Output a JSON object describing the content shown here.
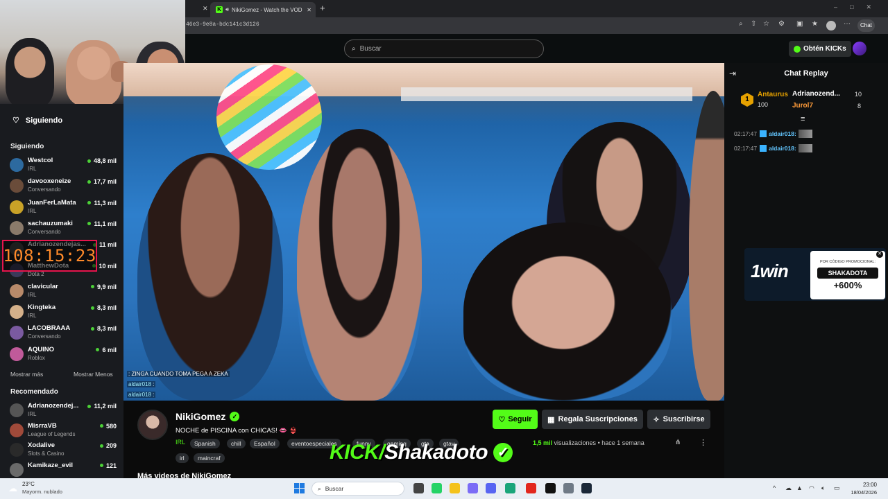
{
  "browser": {
    "tab_title": "NikiGomez - Watch the VOD",
    "tab_close": "✕",
    "new_tab": "+",
    "url": "46e3-9e8a-bdc141c3d126",
    "chat_button": "Chat"
  },
  "header": {
    "search_placeholder": "Buscar",
    "kicks_button": "Obtén KICKs"
  },
  "sidebar": {
    "following_header": "Siguiendo",
    "following_section": "Siguiendo",
    "following": [
      {
        "name": "Westcol",
        "category": "IRL",
        "viewers": "48,8 mil",
        "color": "#2d6a9f"
      },
      {
        "name": "davooxeneize",
        "category": "Conversando",
        "viewers": "17,7 mil",
        "color": "#6a4c3a"
      },
      {
        "name": "JuanFerLaMata",
        "category": "IRL",
        "viewers": "11,3 mil",
        "color": "#c9a227"
      },
      {
        "name": "sachauzumaki",
        "category": "Conversando",
        "viewers": "11,1 mil",
        "color": "#8a7a6a"
      },
      {
        "name": "Adrianozendejas...",
        "category": "",
        "viewers": "11 mil",
        "color": "#444"
      },
      {
        "name": "MatthewDota",
        "category": "Dota 2",
        "viewers": "10 mil",
        "color": "#3a3a5a"
      },
      {
        "name": "clavicular",
        "category": "IRL",
        "viewers": "9,9 mil",
        "color": "#b88a6a"
      },
      {
        "name": "Kingteka",
        "category": "IRL",
        "viewers": "8,3 mil",
        "color": "#d4b08a"
      },
      {
        "name": "LACOBRAAA",
        "category": "Conversando",
        "viewers": "8,3 mil",
        "color": "#7a5aa0"
      },
      {
        "name": "AQUINO",
        "category": "Roblox",
        "viewers": "6 mil",
        "color": "#c05a9a"
      }
    ],
    "show_more": "Mostrar más",
    "show_less": "Mostrar Menos",
    "recommended_section": "Recomendado",
    "recommended": [
      {
        "name": "Adrianozendej...",
        "category": "IRL",
        "viewers": "11,2 mil",
        "color": "#555"
      },
      {
        "name": "MisrraVB",
        "category": "League of Legends",
        "viewers": "580",
        "color": "#a04a3a"
      },
      {
        "name": "Xodalive",
        "category": "Slots & Casino",
        "viewers": "209",
        "color": "#2a2a2a"
      },
      {
        "name": "Kamikaze_evil",
        "category": "",
        "viewers": "121",
        "color": "#6a6a6a"
      }
    ]
  },
  "timer": "108:15:23",
  "video_chat": [
    {
      "user": "",
      "text": ": ZINGA CUANDO TOMA PEGA A ZEKA"
    },
    {
      "user": "aldair018",
      "text": " :"
    },
    {
      "user": "aldair018",
      "text": " :"
    }
  ],
  "stream": {
    "streamer": "NikiGomez",
    "title": "NOCHE de PISCINA con CHICAS! 👄 👙",
    "category": "IRL",
    "tags": [
      "Spanish",
      "chill",
      "Español",
      "eventoespeciales",
      "funny",
      "gaming",
      "gta",
      "gtav",
      "irl",
      "maincraf"
    ],
    "follow_button": "Seguir",
    "gift_button": "Regala Suscripciones",
    "subscribe_button": "Suscribirse",
    "views_count": "1,5 mil",
    "views_label": "visualizaciones",
    "time_ago": "hace 1 semana",
    "more_videos": "Más videos de NikiGomez"
  },
  "watermark": {
    "kick": "KICK/",
    "name": "Shakadoto",
    "check": "✓"
  },
  "chat": {
    "title": "Chat Replay",
    "leaderboard": [
      {
        "rank": "1",
        "name": "Antaurus",
        "amount": "100"
      },
      {
        "name": "Adrianozend...",
        "amount": "10"
      },
      {
        "name": "Jurol7",
        "amount": "8"
      }
    ],
    "messages": [
      {
        "time": "02:17:47",
        "user": "aldair018:"
      },
      {
        "time": "02:17:47",
        "user": "aldair018:"
      }
    ]
  },
  "ad": {
    "logo": "1win",
    "promo_label": "POR CÓDIGO PROMOCIONAL:",
    "code": "SHAKADOTA",
    "bonus": "+600%"
  },
  "taskbar": {
    "temperature": "23°C",
    "weather": "Mayorm. nublado",
    "search": "Buscar",
    "time": "23:00",
    "date": "18/04/2026"
  },
  "colors": {
    "kick_green": "#53fc18",
    "timer_border": "#e6154d",
    "timer_text": "#ff8a2a"
  }
}
